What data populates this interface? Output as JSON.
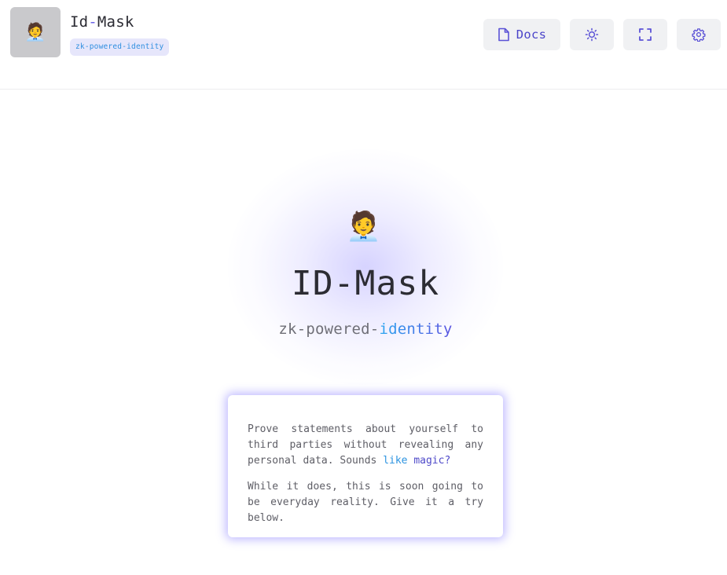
{
  "header": {
    "logo_emoji": "🧑‍💼",
    "title_part1": "Id",
    "title_dash": "-",
    "title_part2": "Mask",
    "badge": "zk-powered-identity",
    "buttons": {
      "docs_label": "Docs",
      "docs_icon": "document-icon",
      "theme_icon": "sun-icon",
      "fullscreen_icon": "fullscreen-icon",
      "settings_icon": "gear-icon"
    }
  },
  "hero": {
    "emoji": "🧑‍💼",
    "title": "ID-Mask",
    "subtitle_plain": "zk-powered-",
    "subtitle_accent": "identity"
  },
  "card": {
    "para1_text": "Prove statements about yourself to third parties without revealing any personal data. Sounds ",
    "para1_link_a": "like",
    "para1_link_b": " magic?",
    "para2_text": "While it does, this is soon going to be everyday reality. Give it a try below."
  },
  "colors": {
    "accent": "#5b52d6",
    "link": "#2b93e0",
    "glow": "#7a6eff"
  }
}
